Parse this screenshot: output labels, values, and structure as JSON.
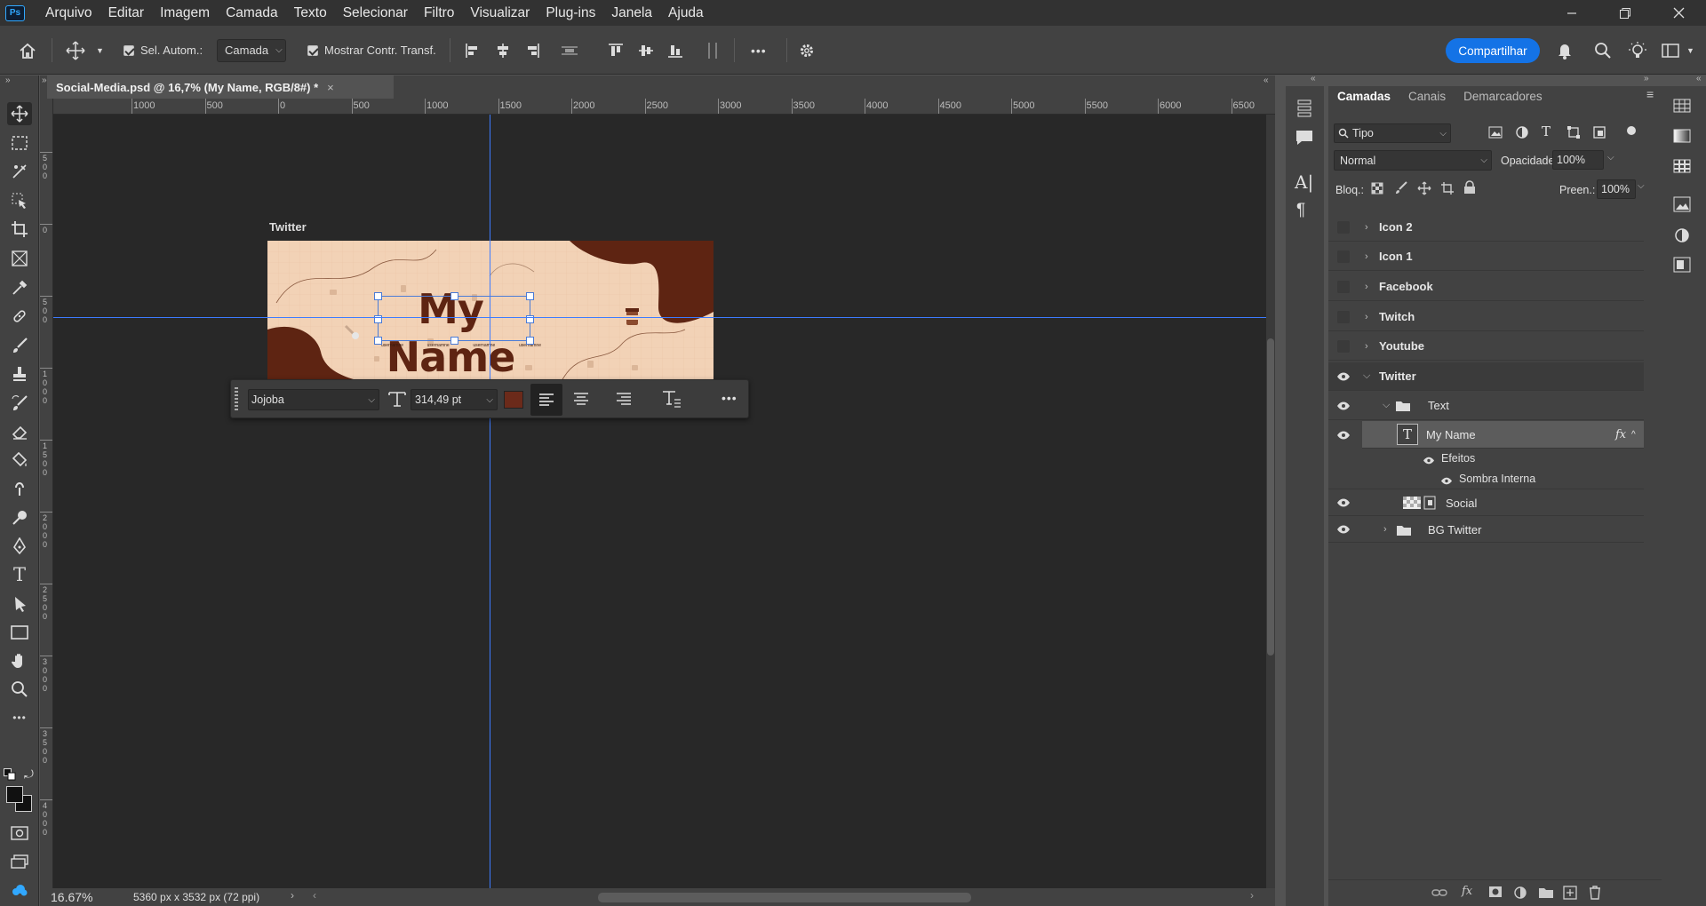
{
  "app": {
    "logo": "Ps"
  },
  "menu": [
    "Arquivo",
    "Editar",
    "Imagem",
    "Camada",
    "Texto",
    "Selecionar",
    "Filtro",
    "Visualizar",
    "Plug-ins",
    "Janela",
    "Ajuda"
  ],
  "window_controls": {
    "minimize": "minimize-icon",
    "restore": "restore-icon",
    "close": "close-icon"
  },
  "options_bar": {
    "auto_select_label": "Sel. Autom.:",
    "auto_select_value": "Camada",
    "show_transform_label": "Mostrar Contr. Transf.",
    "more": "•••",
    "share_label": "Compartilhar"
  },
  "document": {
    "tab_title": "Social-Media.psd @ 16,7% (My Name, RGB/8#) *"
  },
  "ruler_h_labels": [
    "1000",
    "500",
    "0",
    "500",
    "1000",
    "1500",
    "2000",
    "2500",
    "3000",
    "3500",
    "4000",
    "4500",
    "5000",
    "5500",
    "6000",
    "6500"
  ],
  "ruler_v_labels": [
    "5 0 0",
    "0",
    "5 0 0",
    "1 0 0 0",
    "1 5 0 0",
    "2 0 0 0",
    "2 5 0 0",
    "3 0 0 0",
    "3 5 0 0",
    "4 0 0 0"
  ],
  "artboard": {
    "label": "Twitter",
    "headline": "My Name",
    "socials": [
      "usernamne",
      "usernamne",
      "usernamne",
      "usernamne"
    ]
  },
  "context_bar": {
    "font": "Jojoba",
    "size": "314,49 pt",
    "more": "•••",
    "color": "#6b2a1a"
  },
  "status": {
    "zoom": "16.67%",
    "doc_info": "5360 px x 3532 px (72 ppi)"
  },
  "layers_panel": {
    "tabs": [
      "Camadas",
      "Canais",
      "Demarcadores"
    ],
    "filter_value": "Tipo",
    "blend_mode": "Normal",
    "opacity_label": "Opacidade:",
    "opacity_value": "100%",
    "lock_label": "Bloq.:",
    "fill_label": "Preen.:",
    "fill_value": "100%",
    "layers": [
      {
        "name": "Icon 2",
        "visible": false,
        "bold": true
      },
      {
        "name": "Icon 1",
        "visible": false,
        "bold": true
      },
      {
        "name": "Facebook",
        "visible": false,
        "bold": true
      },
      {
        "name": "Twitch",
        "visible": false,
        "bold": true
      },
      {
        "name": "Youtube",
        "visible": false,
        "bold": true
      },
      {
        "name": "Twitter",
        "visible": true,
        "bold": true
      },
      {
        "name": "Text",
        "visible": true,
        "bold": false
      },
      {
        "name": "My Name",
        "visible": true,
        "bold": false
      },
      {
        "name": "Efeitos",
        "visible": true,
        "bold": false
      },
      {
        "name": "Sombra Interna",
        "visible": true,
        "bold": false
      },
      {
        "name": "Social",
        "visible": true,
        "bold": false
      },
      {
        "name": "BG Twitter",
        "visible": true,
        "bold": false
      }
    ],
    "fx_label": "fx"
  },
  "colors": {
    "accent": "#1473e6",
    "guide": "#3d7bff",
    "artboard_bg": "#f2d2b6",
    "brown": "#5e2412"
  }
}
